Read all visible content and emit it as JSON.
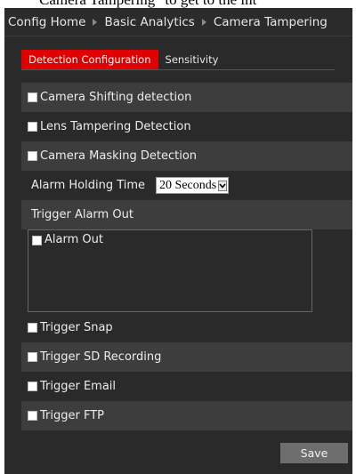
{
  "doc_fragment": "Camera Tampering\" to get to the int",
  "breadcrumb": {
    "items": [
      "Config Home",
      "Basic Analytics",
      "Camera Tampering"
    ]
  },
  "tabs": [
    {
      "label": "Detection Configuration",
      "active": true
    },
    {
      "label": "Sensitivity",
      "active": false
    }
  ],
  "detection": {
    "shifting": "Camera Shifting detection",
    "lens": "Lens Tampering Detection",
    "masking": "Camera Masking Detection"
  },
  "alarm_holding": {
    "label": "Alarm Holding Time",
    "value": "20 Seconds"
  },
  "trigger_alarm_out": {
    "label": "Trigger Alarm Out",
    "alarm_out": "Alarm Out"
  },
  "triggers": {
    "snap": "Trigger Snap",
    "sd": "Trigger SD Recording",
    "email": "Trigger Email",
    "ftp": "Trigger FTP"
  },
  "save_label": "Save",
  "colors": {
    "accent": "#e00000",
    "panel_bg": "#2a2a2a",
    "row_alt": "#3d3d3d",
    "button": "#6e6e6e"
  },
  "icons": {
    "breadcrumb_separator": "triangle-right-icon",
    "dropdown": "chevron-down-icon"
  }
}
